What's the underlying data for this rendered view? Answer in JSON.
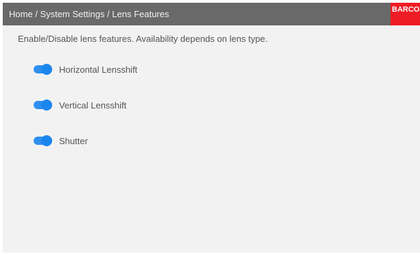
{
  "header": {
    "breadcrumb": "Home / System Settings / Lens Features",
    "brand": "BARCO"
  },
  "main": {
    "description": "Enable/Disable lens features. Availability depends on lens type.",
    "toggles": [
      {
        "label": "Horizontal Lensshift",
        "state": "on"
      },
      {
        "label": "Vertical Lensshift",
        "state": "on"
      },
      {
        "label": "Shutter",
        "state": "on"
      }
    ]
  },
  "colors": {
    "header_bg": "#696969",
    "brand_bg": "#ee1c25",
    "toggle_on": "#1a86ee",
    "panel_bg": "#f2f2f2"
  }
}
